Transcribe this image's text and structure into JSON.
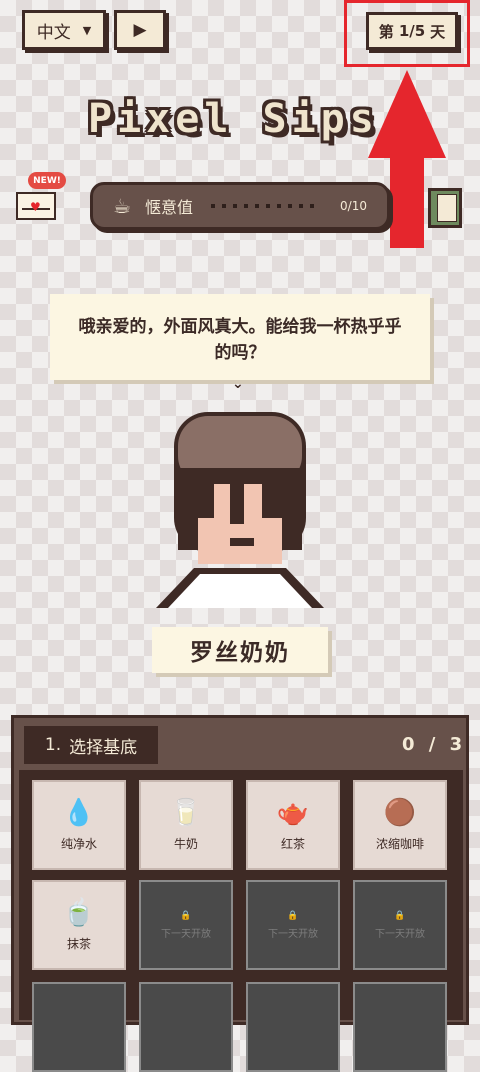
{
  "header": {
    "language": "中文",
    "language_arrow": "▼",
    "play_icon": "▶",
    "day_prefix": "第",
    "day_value": "1/5",
    "day_suffix": "天"
  },
  "title": "Pixel Sips",
  "mail": {
    "badge": "NEW!",
    "icon": "heart-envelope-icon"
  },
  "meter": {
    "icon": "☕",
    "label": "惬意值",
    "count": "0/10",
    "progress": 0
  },
  "dialogue": {
    "text": "哦亲爱的，外面风真大。能给我一杯热乎乎的吗？",
    "tail": "⌄"
  },
  "customer": {
    "name": "罗丝奶奶"
  },
  "panel": {
    "step_number": "1.",
    "step_title": "选择基底",
    "step_count": "0 / 3",
    "items": [
      {
        "label": "纯净水",
        "emoji": "💧",
        "icon": "water-drop-icon",
        "locked": false
      },
      {
        "label": "牛奶",
        "emoji": "🥛",
        "icon": "milk-icon",
        "locked": false
      },
      {
        "label": "红茶",
        "emoji": "🫖",
        "icon": "teapot-icon",
        "locked": false
      },
      {
        "label": "浓缩咖啡",
        "emoji": "🟤",
        "icon": "coffee-bean-icon",
        "locked": false
      },
      {
        "label": "抹茶",
        "emoji": "🍵",
        "icon": "tea-cup-icon",
        "locked": false
      },
      {
        "label": "下一天开放",
        "emoji": "🔒",
        "icon": "lock-icon",
        "locked": true
      },
      {
        "label": "下一天开放",
        "emoji": "🔒",
        "icon": "lock-icon",
        "locked": true
      },
      {
        "label": "下一天开放",
        "emoji": "🔒",
        "icon": "lock-icon",
        "locked": true
      }
    ]
  },
  "colors": {
    "accent_red": "#e5262d",
    "panel_brown": "#67514a",
    "dark_brown": "#3e2a25",
    "cream": "#f4ead6"
  }
}
